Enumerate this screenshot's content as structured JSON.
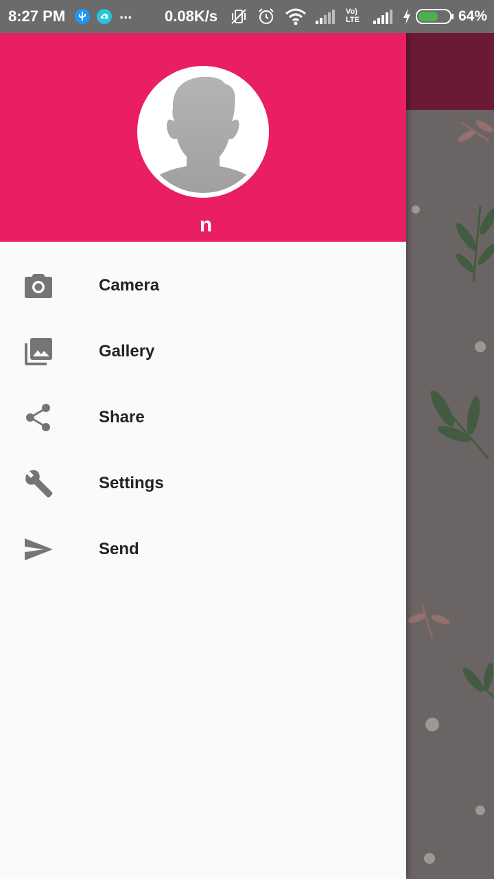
{
  "status_bar": {
    "time": "8:27 PM",
    "more": "...",
    "network_speed": "0.08K/s",
    "volte_label": "Vo) LTE",
    "battery_percent": "64%",
    "battery_level": 0.64,
    "icons": [
      "usb-icon",
      "cloud-upload-icon",
      "vibrate-off-icon",
      "alarm-icon",
      "wifi-icon",
      "signal-icon",
      "volte-icon",
      "charging-icon",
      "battery-icon"
    ]
  },
  "drawer": {
    "header_color": "#e91e63",
    "user_name": "n",
    "menu": [
      {
        "label": "Camera",
        "icon": "camera-icon"
      },
      {
        "label": "Gallery",
        "icon": "gallery-icon"
      },
      {
        "label": "Share",
        "icon": "share-icon"
      },
      {
        "label": "Settings",
        "icon": "wrench-icon"
      },
      {
        "label": "Send",
        "icon": "send-icon"
      }
    ]
  },
  "colors": {
    "accent": "#e91e63",
    "icon_gray": "#757575",
    "text": "#222222",
    "battery_green": "#4caf50"
  }
}
